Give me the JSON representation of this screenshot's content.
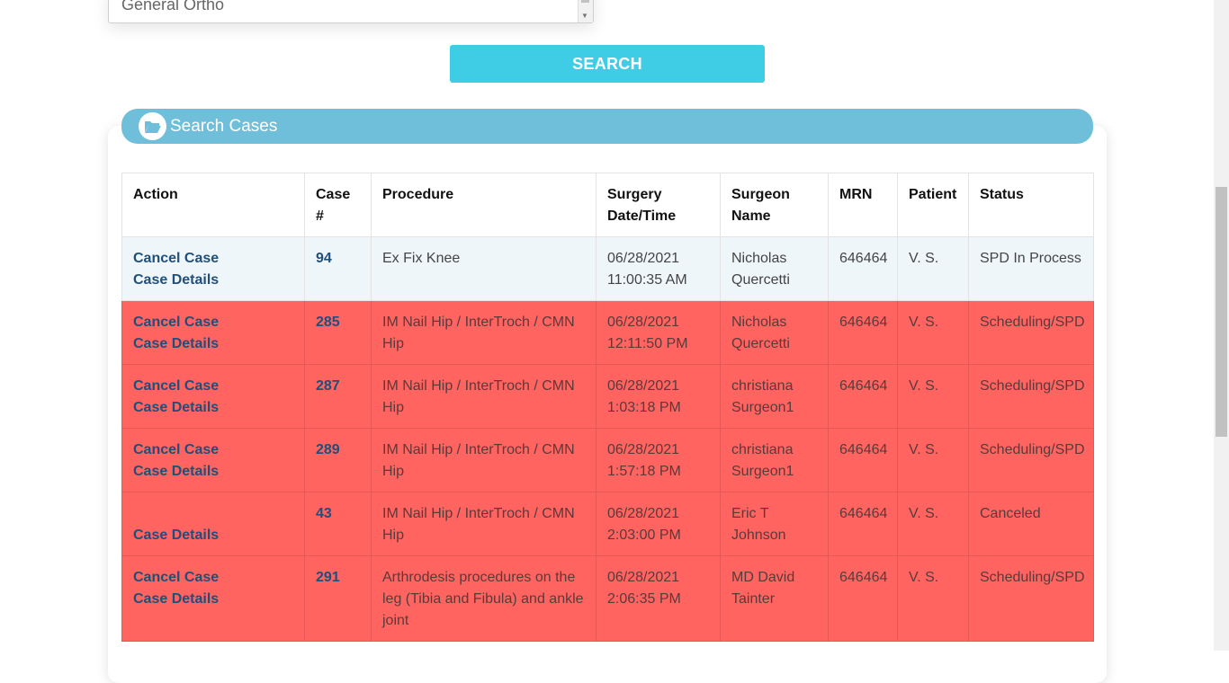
{
  "specialty_select": {
    "visible_option": "General Ortho"
  },
  "search_button": {
    "label": "SEARCH"
  },
  "panel": {
    "title": "Search Cases",
    "icon": "folder-open-icon"
  },
  "table": {
    "headers": {
      "action": "Action",
      "case": "Case #",
      "procedure": "Procedure",
      "surgery_date_1": "Surgery",
      "surgery_date_2": "Date/Time",
      "surgeon_1": "Surgeon",
      "surgeon_2": "Name",
      "mrn": "MRN",
      "patient": "Patient",
      "status": "Status"
    },
    "rows": [
      {
        "cancel": "Cancel Case",
        "details": "Case Details",
        "case": "94",
        "procedure": "Ex Fix Knee",
        "date": "06/28/2021",
        "time": "11:00:35 AM",
        "surgeon_first": "Nicholas",
        "surgeon_last": "Quercetti",
        "mrn": "646464",
        "patient": "V. S.",
        "status": "SPD In Process"
      },
      {
        "cancel": "Cancel Case",
        "details": "Case Details",
        "case": "285",
        "procedure": "IM Nail Hip / InterTroch / CMN Hip",
        "date": "06/28/2021",
        "time": "12:11:50 PM",
        "surgeon_first": "Nicholas",
        "surgeon_last": "Quercetti",
        "mrn": "646464",
        "patient": "V. S.",
        "status": "Scheduling/SPD"
      },
      {
        "cancel": "Cancel Case",
        "details": "Case Details",
        "case": "287",
        "procedure": "IM Nail Hip / InterTroch / CMN Hip",
        "date": "06/28/2021",
        "time": "1:03:18 PM",
        "surgeon_first": "christiana",
        "surgeon_last": "Surgeon1",
        "mrn": "646464",
        "patient": "V. S.",
        "status": "Scheduling/SPD"
      },
      {
        "cancel": "Cancel Case",
        "details": "Case Details",
        "case": "289",
        "procedure": "IM Nail Hip / InterTroch / CMN Hip",
        "date": "06/28/2021",
        "time": "1:57:18 PM",
        "surgeon_first": "christiana",
        "surgeon_last": "Surgeon1",
        "mrn": "646464",
        "patient": "V. S.",
        "status": "Scheduling/SPD"
      },
      {
        "cancel": "",
        "details": "Case Details",
        "case": "43",
        "procedure": "IM Nail Hip / InterTroch / CMN Hip",
        "date": "06/28/2021",
        "time": "2:03:00 PM",
        "surgeon_first": "Eric T",
        "surgeon_last": "Johnson",
        "mrn": "646464",
        "patient": "V. S.",
        "status": "Canceled"
      },
      {
        "cancel": "Cancel Case",
        "details": "Case Details",
        "case": "291",
        "procedure": "Arthrodesis procedures on the leg (Tibia and Fibula) and ankle joint",
        "date": "06/28/2021",
        "time": "2:06:35 PM",
        "surgeon_first": "MD David",
        "surgeon_last": "Tainter",
        "mrn": "646464",
        "patient": "V. S.",
        "status": "Scheduling/SPD"
      }
    ]
  },
  "colors": {
    "search_button": "#3fcde6",
    "panel_header": "#6fbfdb",
    "row_highlight": "#ff6460",
    "row_normal": "#eef6fa",
    "link": "#1f4f7a"
  }
}
